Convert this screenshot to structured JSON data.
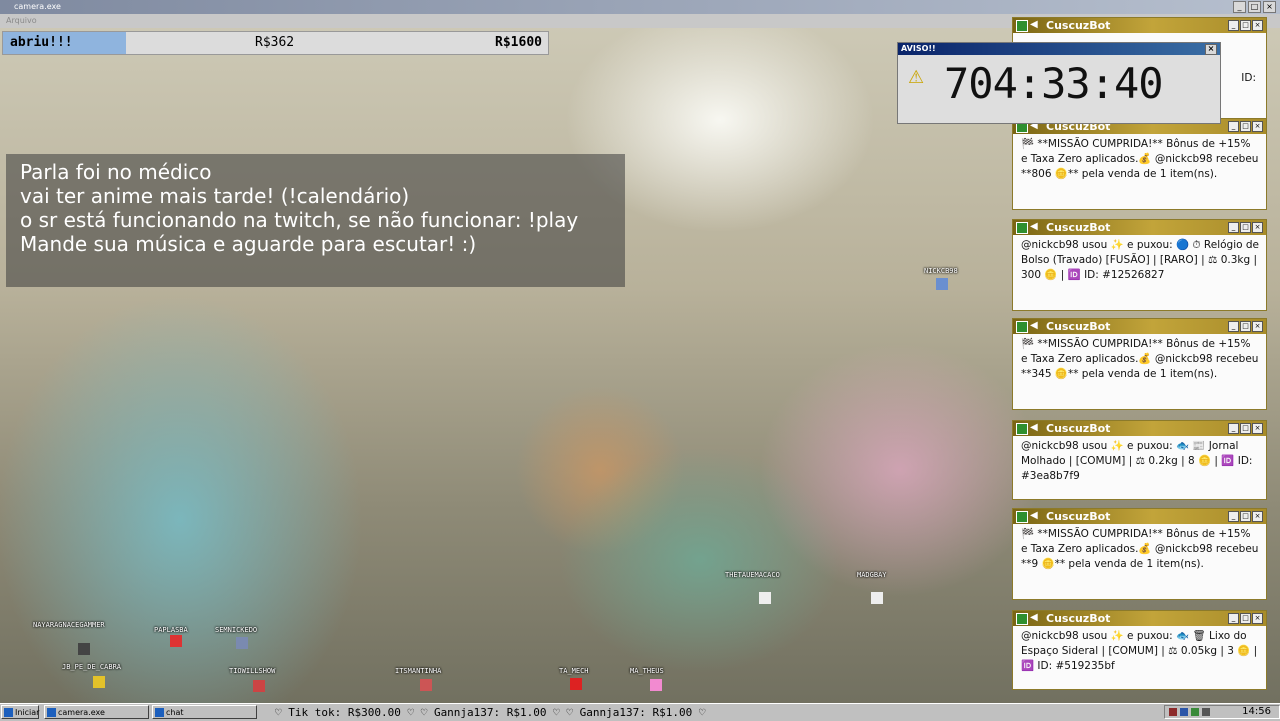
{
  "window": {
    "title": "camera.exe",
    "menu": "Arquivo"
  },
  "goal": {
    "label": "abriu!!!",
    "current": "R$362",
    "target": "R$1600",
    "progress_fraction": 0.226
  },
  "notice": {
    "lines": [
      "Parla foi no médico",
      "vai ter anime mais tarde! (!calendário)",
      "o sr está funcionando na twitch, se não funcionar: !play",
      "Mande sua música e aguarde para escutar! :)"
    ]
  },
  "timer": {
    "title": "AVISO!!",
    "value": "704:33:40"
  },
  "bot_windows": {
    "title": "CuscuzBot",
    "partial_text": "ID:",
    "messages": [
      "🏁 **MISSÃO CUMPRIDA!** Bônus de +15% e Taxa Zero aplicados.💰 @nickcb98 recebeu **806 🪙** pela venda de 1 item(ns).",
      "@nickcb98 usou ✨ e puxou: 🔵 ⏱ Relógio de Bolso (Travado) [FUSÃO] | [RARO] | ⚖ 0.3kg | 300 🪙 | 🆔 ID: #12526827",
      "🏁 **MISSÃO CUMPRIDA!** Bônus de +15% e Taxa Zero aplicados.💰 @nickcb98 recebeu **345 🪙** pela venda de 1 item(ns).",
      "@nickcb98 usou ✨ e puxou: 🐟 📰 Jornal Molhado | [COMUM] | ⚖ 0.2kg | 8 🪙 | 🆔 ID: #3ea8b7f9",
      "🏁 **MISSÃO CUMPRIDA!** Bônus de +15% e Taxa Zero aplicados.💰 @nickcb98 recebeu **9 🪙** pela venda de 1 item(ns).",
      "@nickcb98 usou ✨ e puxou: 🐟 🗑 Lixo do Espaço Sideral | [COMUM] | ⚖ 0.05kg | 3 🪙 | 🆔 ID: #519235bf"
    ]
  },
  "avatars": [
    "NICKCB98",
    "NAYARAGNACEGAMMER",
    "PAPLASBA",
    "SEMNICKEDO",
    "JB_PE_DE_CABRA",
    "TIOWILLSHOW",
    "ITSMANTINHA",
    "TA_MECH",
    "MA_THEUS",
    "THETAUEMACACO",
    "MADGBAY"
  ],
  "taskbar": {
    "start_label": "Iniciar",
    "tasks": [
      "camera.exe",
      "chat"
    ],
    "ticker": "♡ Tik tok: R$300.00 ♡   ♡ Gannja137: R$1.00 ♡   ♡ Gannja137: R$1.00 ♡",
    "clock": "14:56"
  },
  "colors": {
    "goal_fill": "#8fb4de",
    "bot_titlebar": "#c2a43a",
    "timer_titlebar": "#0a246a",
    "taskbar": "#c0c0c0"
  }
}
